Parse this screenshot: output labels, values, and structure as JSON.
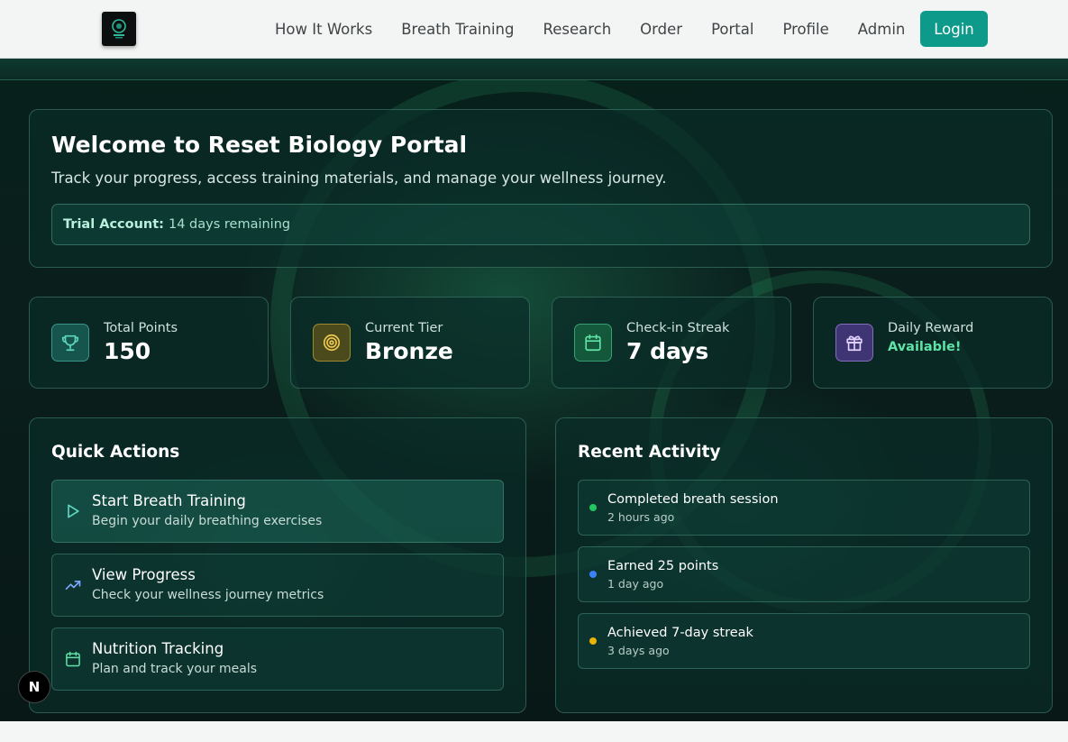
{
  "nav": {
    "links": [
      "How It Works",
      "Breath Training",
      "Research",
      "Order",
      "Portal",
      "Profile",
      "Admin"
    ],
    "login_label": "Login"
  },
  "welcome": {
    "title": "Welcome to Reset Biology Portal",
    "subtitle": "Track your progress, access training materials, and manage your wellness journey.",
    "trial_label": "Trial Account:",
    "trial_value": "14 days remaining"
  },
  "stats": [
    {
      "label": "Total Points",
      "value": "150",
      "icon": "trophy-icon",
      "color": "#5ed6c0"
    },
    {
      "label": "Current Tier",
      "value": "Bronze",
      "icon": "target-icon",
      "color": "#f2c94c"
    },
    {
      "label": "Check-in Streak",
      "value": "7 days",
      "icon": "calendar-icon",
      "color": "#5fe3a6"
    },
    {
      "label": "Daily Reward",
      "value": "Available!",
      "icon": "gift-icon",
      "color": "#c9a7ff"
    }
  ],
  "quick_actions": {
    "title": "Quick Actions",
    "items": [
      {
        "title": "Start Breath Training",
        "subtitle": "Begin your daily breathing exercises",
        "icon": "play-icon"
      },
      {
        "title": "View Progress",
        "subtitle": "Check your wellness journey metrics",
        "icon": "trending-up-icon"
      },
      {
        "title": "Nutrition Tracking",
        "subtitle": "Plan and track your meals",
        "icon": "calendar-icon"
      }
    ]
  },
  "recent_activity": {
    "title": "Recent Activity",
    "items": [
      {
        "title": "Completed breath session",
        "time": "2 hours ago",
        "color": "#22c55e"
      },
      {
        "title": "Earned 25 points",
        "time": "1 day ago",
        "color": "#3b82f6"
      },
      {
        "title": "Achieved 7-day streak",
        "time": "3 days ago",
        "color": "#eab308"
      }
    ]
  },
  "badge": "N"
}
